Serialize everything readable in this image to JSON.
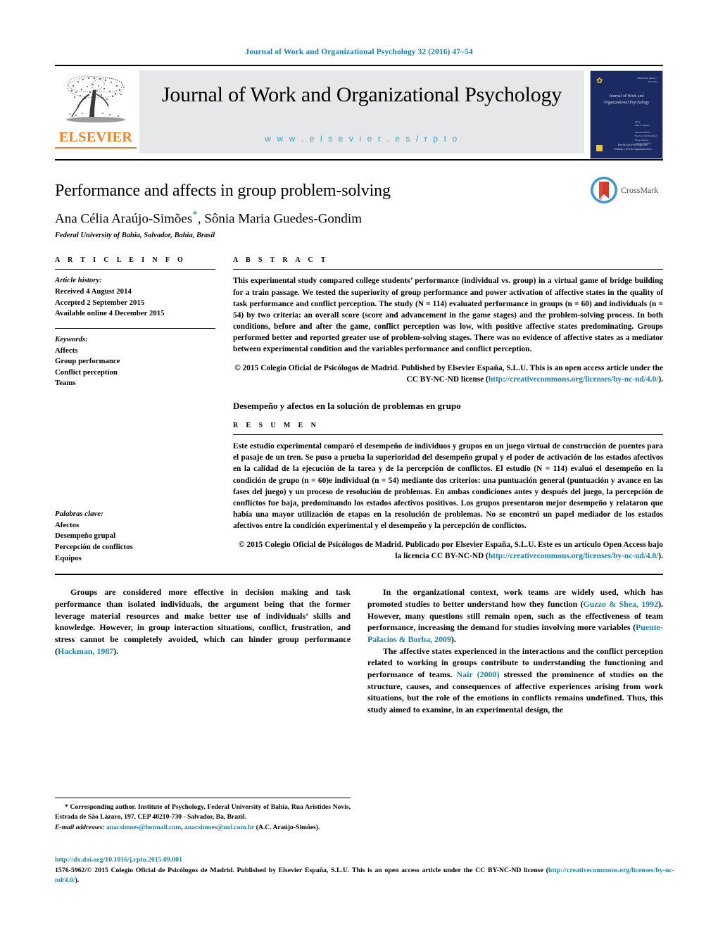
{
  "running_head": "Journal of Work and Organizational Psychology 32 (2016) 47–54",
  "publisher": {
    "name": "ELSEVIER",
    "logo_icon": "elsevier-tree-icon",
    "accent_color": "#F07E26"
  },
  "banner": {
    "journal_title": "Journal of Work and Organizational Psychology",
    "url": "w w w . e l s e v i e r . e s / r p t o",
    "background": "#e6e7e8",
    "url_color": "#3da0c4"
  },
  "cover": {
    "top_right_line1": "Volumen 32, número 1",
    "top_right_line2": "Abril 2016",
    "title_line1": "Journal of Work and",
    "title_line2": "Organizational Psychology",
    "editors_label": "Editor",
    "editors": "Jesús F. Salgado",
    "assoc_label": "Associate Editors",
    "assoc1": "Francisco Gil Rodríguez",
    "assoc2": "Silvia Moscoso",
    "assoc3": "Carmen Tabernero",
    "footer_line1": "Revista de Psicología del",
    "footer_line2": "Trabajo y de las Organizaciones",
    "background": "#1c2a63",
    "accent": "#e8c63a"
  },
  "article": {
    "title": "Performance and affects in group problem-solving",
    "authors": "Ana Célia Araújo-Simões",
    "corresponding_marker": "*",
    "authors_rest": ", Sônia Maria Guedes-Gondim",
    "affiliation": "Federal University of Bahia, Salvador, Bahia, Brasil",
    "crossmark_label": "CrossMark"
  },
  "article_info": {
    "heading": "A R T I C L E   I N F O",
    "history_label": "Article history:",
    "received": "Received 4 August 2014",
    "accepted": "Accepted 2 September 2015",
    "available": "Available online 4 December 2015",
    "keywords_label": "Keywords:",
    "keywords": [
      "Affects",
      "Group performance",
      "Conflict perception",
      "Teams"
    ],
    "palabras_label": "Palabras clave:",
    "palabras": [
      "Afectos",
      "Desempeño grupal",
      "Percepción de conflictos",
      "Equipos"
    ]
  },
  "abstract": {
    "heading": "A B S T R A C T",
    "text": "This experimental study compared college students’ performance (individual vs. group) in a virtual game of bridge building for a train passage. We tested the superiority of group performance and power activation of affective states in the quality of task performance and conflict perception. The study (N = 114) evaluated performance in groups (n = 60) and individuals (n = 54) by two criteria: an overall score (score and advancement in the game stages) and the problem-solving process. In both conditions, before and after the game, conflict perception was low, with positive affective states predominating. Groups performed better and reported greater use of problem-solving stages. There was no evidence of affective states as a mediator between experimental condition and the variables performance and conflict perception.",
    "copyright_pre": "© 2015 Colegio Oficial de Psicólogos de Madrid. Published by Elsevier España, S.L.U. This is an open access article under the CC BY-NC-ND license (",
    "copyright_link": "http://creativecommons.org/licenses/by-nc-nd/4.0/",
    "copyright_post": ")."
  },
  "resumen": {
    "spanish_title": "Desempeño y afectos en la solución de problemas en grupo",
    "heading": "R E S U M E N",
    "text": "Este estudio experimental comparó el desempeño de individuos y grupos en un juego virtual de construcción de puentes para el pasaje de un tren. Se puso a prueba la superioridad del desempeño grupal y el poder de activación de los estados afectivos en la calidad de la ejecución de la tarea y de la percepción de conflictos. El estudio (N = 114) evaluó el desempeño en la condición de grupo (n = 60)e individual (n = 54) mediante dos criterios: una puntuación general (puntuación y avance en las fases del juego) y un proceso de resolución de problemas. En ambas condiciones antes y después del juego, la percepción de conflictos fue baja, predominando los estados afectivos positivos. Los grupos presentaron mejor desempeño y relataron que había una mayor utilización de etapas en la resolución de problemas. No se encontró un papel mediador de los estados afectivos entre la condición experimental y el desempeño y la percepción de conflictos.",
    "copyright_pre": "© 2015 Colegio Oficial de Psicólogos de Madrid. Publicado por Elsevier España, S.L.U. Este es un artículo Open Access bajo la licencia CC BY-NC-ND (",
    "copyright_link": "http://creativecommons.org/licenses/by-nc-nd/4.0/",
    "copyright_post": ")."
  },
  "body": {
    "left_p1_a": "Groups are considered more effective in decision making and task performance than isolated individuals, the argument being that the former leverage material resources and make better use of individuals’ skills and knowledge. However, in group interaction situations, conflict, frustration, and stress cannot be completely avoided, which can hinder group performance (",
    "left_p1_cite": "Hackman, 1987",
    "left_p1_b": ").",
    "right_p1_a": "In the organizational context, work teams are widely used, which has promoted studies to better understand how they function (",
    "right_p1_cite1": "Guzzo & Shea, 1992",
    "right_p1_b": "). However, many questions still remain open, such as the effectiveness of team performance, increasing the demand for studies involving more variables (",
    "right_p1_cite2": "Puente-Palacios & Borba, 2009",
    "right_p1_c": ").",
    "right_p2_a": "The affective states experienced in the interactions and the conflict perception related to working in groups contribute to understanding the functioning and performance of teams. ",
    "right_p2_cite": "Nair (2008)",
    "right_p2_b": " stressed the prominence of studies on the structure, causes, and consequences of affective experiences arising from work situations, but the role of the emotions in conflicts remains undefined. Thus, this study aimed to examine, in an experimental design, the"
  },
  "footnote": {
    "star": "*",
    "text": " Corresponding author. Institute of Psychology, Federal University of Bahia, Rua Aristides Novis, Estrada de São Lázaro, 197, CEP 40210-730 - Salvador, Ba, Brazil.",
    "email_label": "E-mail addresses:",
    "email1": "anacsimoes@hotmail.com",
    "email_sep": ", ",
    "email2": "anacsimoes@uol.com.br",
    "email_owner": "(A.C. Araújo-Simões)."
  },
  "legal": {
    "doi": "http://dx.doi.org/10.1016/j.rpto.2015.09.001",
    "line_a": "1576-5962/© 2015 Colegio Oficial de Psicólogos de Madrid. Published by Elsevier España, S.L.U. This is an open access article under the CC BY-NC-ND license (",
    "link": "http://creativecommons.org/licenses/by-nc-nd/4.0/",
    "line_b": ")."
  },
  "colors": {
    "link": "#1a7fa8",
    "elsevier_orange": "#F07E26",
    "banner_gray": "#e6e7e8",
    "cover_navy": "#1c2a63"
  }
}
